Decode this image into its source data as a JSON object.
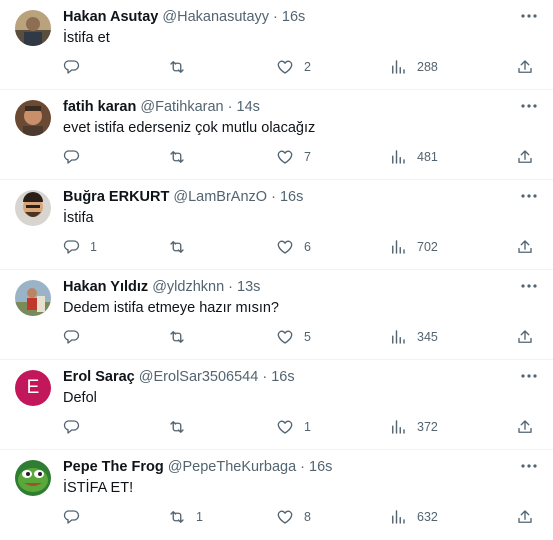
{
  "tweets": [
    {
      "name": "Hakan Asutay",
      "handle": "@Hakanasutayy",
      "separator": "·",
      "time": "16s",
      "text": "İstifa et",
      "replies": "",
      "retweets": "",
      "likes": "2",
      "views": "288",
      "avatar": "photo-avatar"
    },
    {
      "name": "fatih karan",
      "handle": "@Fatihkaran",
      "separator": "·",
      "time": "14s",
      "text": "evet istifa ederseniz çok mutlu olacağız",
      "replies": "",
      "retweets": "",
      "likes": "7",
      "views": "481",
      "avatar": "photo-avatar"
    },
    {
      "name": "Buğra ERKURT",
      "handle": "@LamBrAnzO",
      "separator": "·",
      "time": "16s",
      "text": "İstifa",
      "replies": "1",
      "retweets": "",
      "likes": "6",
      "views": "702",
      "avatar": "photo-avatar"
    },
    {
      "name": "Hakan Yıldız",
      "handle": "@yldzhknn",
      "separator": "·",
      "time": "13s",
      "text": "Dedem istifa etmeye hazır mısın?",
      "replies": "",
      "retweets": "",
      "likes": "5",
      "views": "345",
      "avatar": "photo-avatar"
    },
    {
      "name": "Erol Saraç",
      "handle": "@ErolSar3506544",
      "separator": "·",
      "time": "16s",
      "text": "Defol",
      "replies": "",
      "retweets": "",
      "likes": "1",
      "views": "372",
      "avatar": "letter-avatar",
      "avatar_letter": "E",
      "avatar_color": "#c2185b"
    },
    {
      "name": "Pepe The Frog",
      "handle": "@PepeTheKurbaga",
      "separator": "·",
      "time": "16s",
      "text": "İSTİFA ET!",
      "replies": "",
      "retweets": "1",
      "likes": "8",
      "views": "632",
      "avatar": "frog-avatar"
    }
  ],
  "icons": {
    "reply": "reply-icon",
    "retweet": "retweet-icon",
    "like": "heart-icon",
    "views": "views-icon",
    "share": "share-icon",
    "more": "more-icon"
  },
  "colors": {
    "text": "#0f1419",
    "secondary": "#536471",
    "divider": "#eff3f4"
  }
}
